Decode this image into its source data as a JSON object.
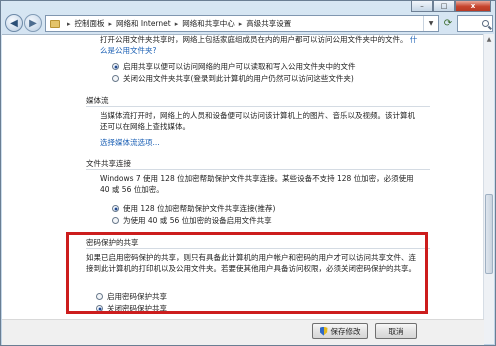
{
  "window": {
    "minimize_glyph": "–",
    "maximize_glyph": "□",
    "close_glyph": "x"
  },
  "address_bar": {
    "crumbs": [
      "控制面板",
      "网络和 Internet",
      "网络和共享中心",
      "高级共享设置"
    ]
  },
  "public_folder_sharing": {
    "text": "打开公用文件夹共享时，网络上包括家庭组成员在内的用户都可以访问公用文件夹中的文件。",
    "link": "什么是公用文件夹?",
    "options": [
      {
        "label": "启用共享以便可以访问网络的用户可以读取和写入公用文件夹中的文件",
        "selected": true
      },
      {
        "label": "关闭公用文件夹共享(登录到此计算机的用户仍然可以访问这些文件夹)",
        "selected": false
      }
    ]
  },
  "media_streaming": {
    "heading": "媒体流",
    "text": "当媒体流打开时，网络上的人员和设备便可以访问该计算机上的图片、音乐以及视频。该计算机还可以在网络上查找媒体。",
    "link": "选择媒体流选项..."
  },
  "file_sharing": {
    "heading": "文件共享连接",
    "text": "Windows 7 使用 128 位加密帮助保护文件共享连接。某些设备不支持 128 位加密，必须使用 40 或 56 位加密。",
    "options": [
      {
        "label": "使用 128 位加密帮助保护文件共享连接(推荐)",
        "selected": true
      },
      {
        "label": "为使用 40 或 56 位加密的设备启用文件共享",
        "selected": false
      }
    ]
  },
  "password_protected": {
    "heading": "密码保护的共享",
    "text": "如果已启用密码保护的共享，则只有具备此计算机的用户帐户和密码的用户才可以访问共享文件、连接到此计算机的打印机以及公用文件夹。若要使其他用户具备访问权限，必须关闭密码保护的共享。",
    "options": [
      {
        "label": "启用密码保护共享",
        "selected": false
      },
      {
        "label": "关闭密码保护共享",
        "selected": true
      }
    ],
    "highlight_color": "#cc1d1d"
  },
  "footer": {
    "save_label": "保存修改",
    "cancel_label": "取消"
  }
}
